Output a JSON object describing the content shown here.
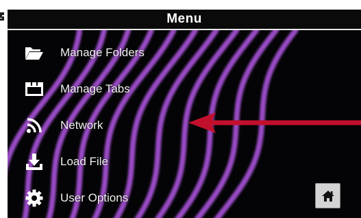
{
  "menu": {
    "title": "Menu",
    "items": [
      {
        "label": "Manage Folders",
        "icon": "folder-open-icon"
      },
      {
        "label": "Manage Tabs",
        "icon": "tabs-icon"
      },
      {
        "label": "Network",
        "icon": "network-wifi-icon"
      },
      {
        "label": "Load File",
        "icon": "download-icon"
      },
      {
        "label": "User Options",
        "icon": "gear-icon"
      }
    ]
  },
  "home_button": {
    "icon": "home-icon"
  },
  "colors": {
    "background": "#040406",
    "waves": "#a24fd0",
    "arrow": "#c2102c",
    "text": "#f2f2f2",
    "home_button": "#d4d4d4"
  }
}
